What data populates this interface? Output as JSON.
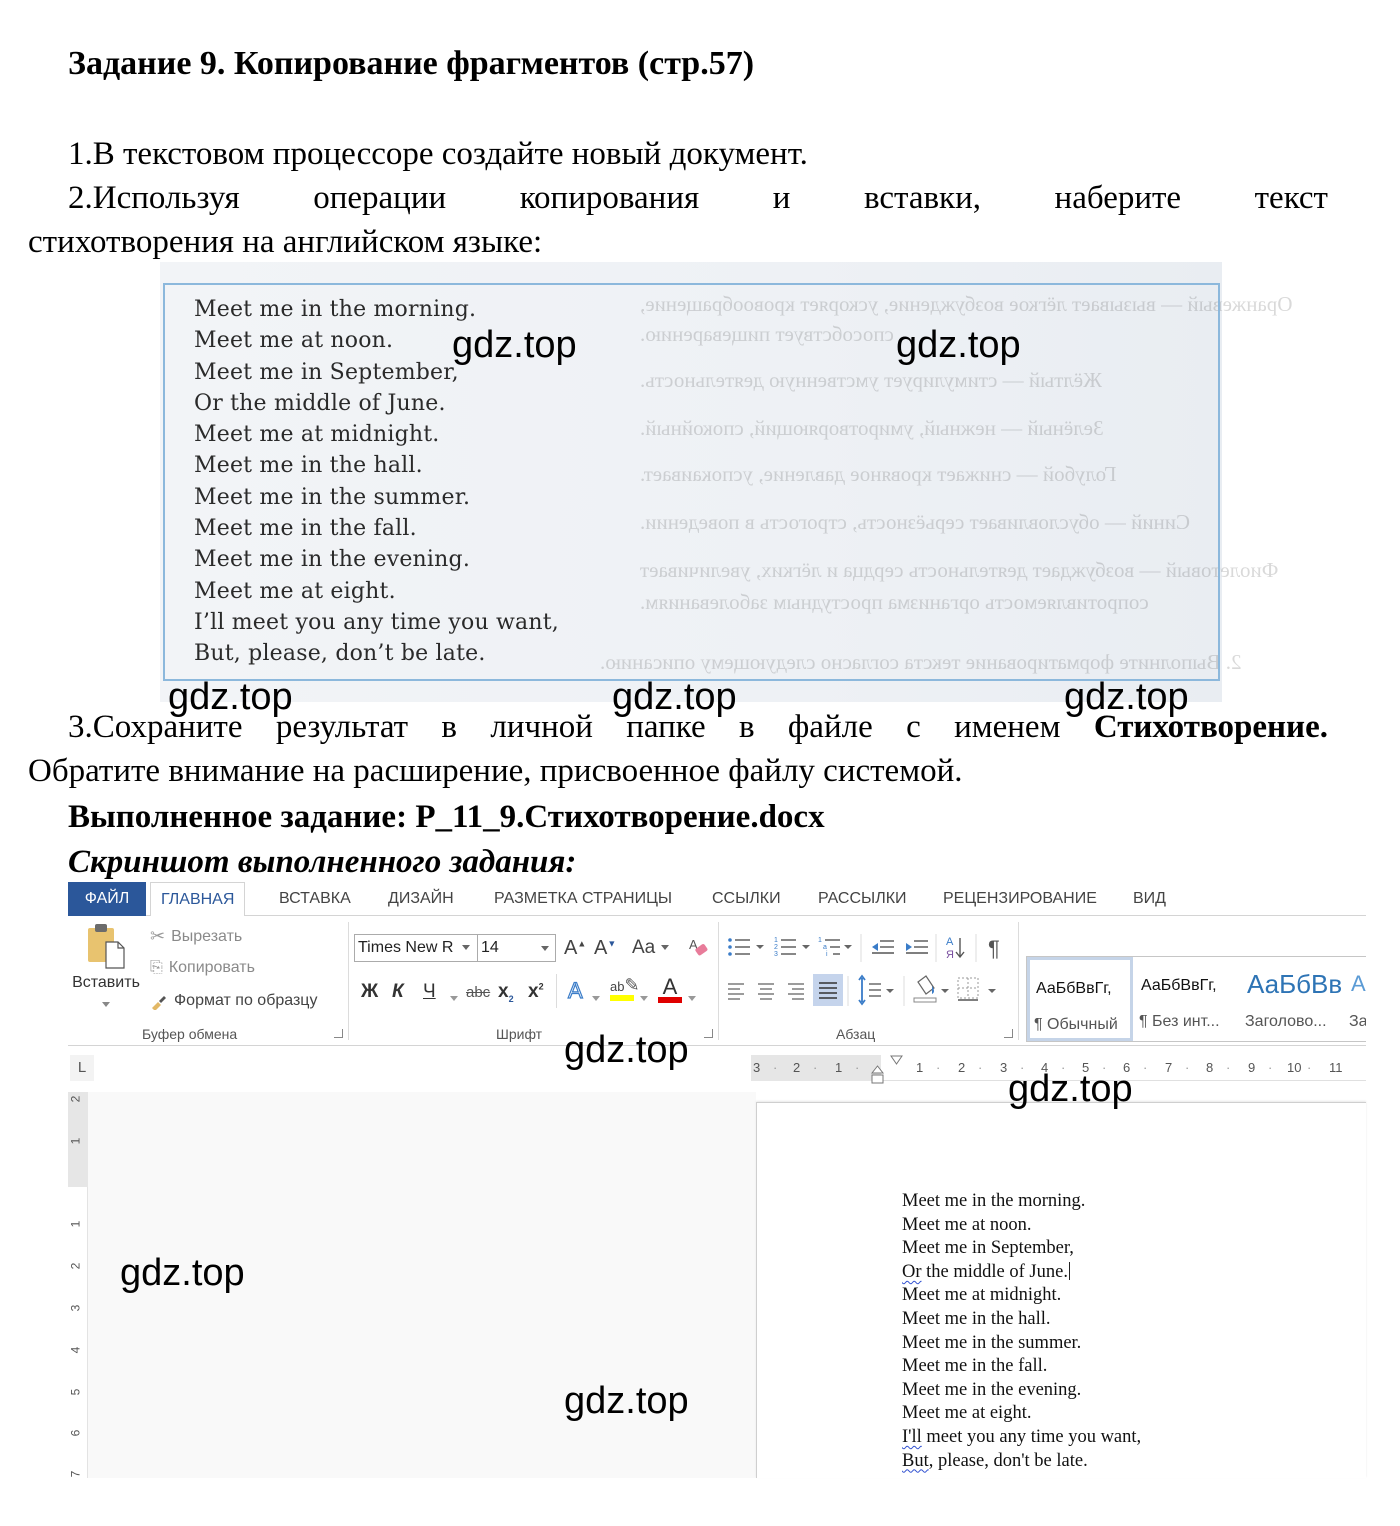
{
  "document": {
    "title": "Задание 9. Копирование фрагментов (стр.57)",
    "step1": "1.В текстовом процессоре создайте новый документ.",
    "step2_words": [
      "2.Используя",
      "операции",
      "копирования",
      "и",
      "вставки,",
      "наберите",
      "текст"
    ],
    "step2_cont": "стихотворения на английском языке:",
    "step3_words": [
      "3.Сохраните",
      "результат",
      "в",
      "личной",
      "папке",
      "в",
      "файле",
      "с",
      "именем"
    ],
    "step3_bold": "Стихотворение.",
    "step3_cont": "Обратите внимание на расширение, присвоенное файлу системой.",
    "done_label": "Выполненное задание: P_11_9.Стихотворение.docx",
    "screenshot_label": "Скриншот выполненного задания:"
  },
  "textbook_scan": {
    "poem": [
      "Meet me in the morning.",
      "Meet me at noon.",
      "Meet me in September,",
      "Or the middle of June.",
      "Meet me at midnight.",
      "Meet me in the hall.",
      "Meet me in the summer.",
      "Meet me in the fall.",
      "Meet me in the evening.",
      "Meet me at eight.",
      "I’ll meet you any time you want,",
      "But, please, don’t be late."
    ],
    "bleed_through": [
      "Оранжевый — вызывает лёгкое возбуждение, ускоряет кровообращение,",
      "способствует пищеварению.",
      "Жёлтый — стимулирует умственную деятельность.",
      "Зелёный — нежный, умиротворяющий, спокойный.",
      "Голубой — снижает кровяное давление, успокаивает.",
      "Синий — обусловливает серьёзность, строгость в поведении.",
      "Фиолетовый — возбуждает деятельность сердца и лёгких, увеличивает",
      "сопротивляемость организма простудным заболеваниям.",
      "2. Выполните форматирование текста согласно следующему описанию."
    ]
  },
  "watermark": "gdz.top",
  "word": {
    "tabs": [
      "ФАЙЛ",
      "ГЛАВНАЯ",
      "ВСТАВКА",
      "ДИЗАЙН",
      "РАЗМЕТКА СТРАНИЦЫ",
      "ССЫЛКИ",
      "РАССЫЛКИ",
      "РЕЦЕНЗИРОВАНИЕ",
      "ВИД"
    ],
    "active_tab": "ГЛАВНАЯ",
    "clipboard": {
      "paste": "Вставить",
      "cut": "Вырезать",
      "copy": "Копировать",
      "format_painter": "Формат по образцу",
      "group_label": "Буфер обмена"
    },
    "font": {
      "font_name": "Times New R",
      "font_size": "14",
      "grow": "A",
      "shrink": "A",
      "change_case": "Aa",
      "bold": "Ж",
      "italic": "К",
      "underline": "Ч",
      "strike": "abc",
      "subscript": "x",
      "subscript_mark": "2",
      "superscript": "x",
      "superscript_mark": "2",
      "text_effects": "A",
      "highlight": "ab",
      "font_color": "A",
      "group_label": "Шрифт",
      "highlight_color": "#ffff00",
      "font_color_value": "#e00000"
    },
    "paragraph": {
      "group_label": "Абзац",
      "pilcrow": "¶",
      "sort": "А↓",
      "active_alignment": "justify"
    },
    "styles": [
      {
        "sample": "АаБбВвГг,",
        "name": "¶ Обычный",
        "selected": true
      },
      {
        "sample": "АаБбВвГг,",
        "name": "¶ Без инт...",
        "selected": false
      },
      {
        "sample": "АаБбВв",
        "name": "Заголово...",
        "selected": false
      },
      {
        "sample": "А",
        "name": "За",
        "selected": false
      }
    ],
    "tab_selector": "L",
    "hruler_numbers": [
      "3",
      "2",
      "1",
      "1",
      "2",
      "3",
      "4",
      "5",
      "6",
      "7",
      "8",
      "9",
      "10",
      "11"
    ],
    "vruler_numbers": [
      "2",
      "1",
      "1",
      "2",
      "3",
      "4",
      "5",
      "6",
      "7"
    ],
    "page_poem": [
      "Meet me in the morning.",
      "Meet me at noon.",
      "Meet me in September,",
      "Or the middle of June.",
      "Meet me at midnight.",
      "Meet me in the hall.",
      "Meet me in the summer.",
      "Meet me in the fall.",
      "Meet me in the evening.",
      "Meet me at eight.",
      "I'll meet you any time you want,",
      "But, please, don't be late."
    ],
    "accent_color": "#2b579a"
  }
}
